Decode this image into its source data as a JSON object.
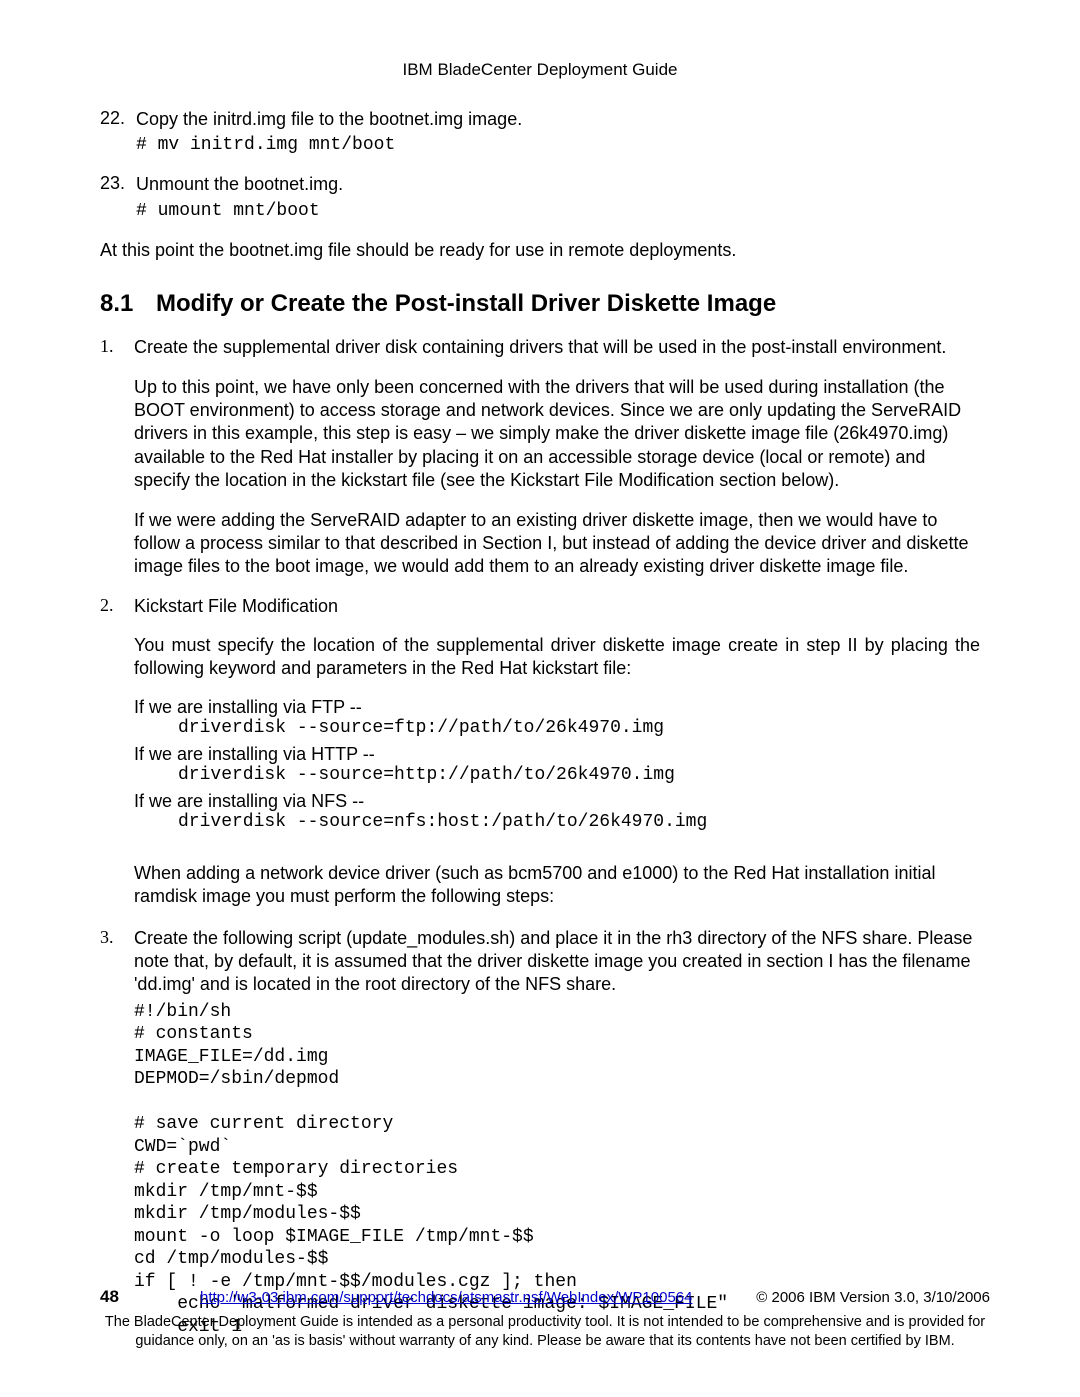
{
  "header": {
    "title": "IBM BladeCenter Deployment Guide"
  },
  "steps": {
    "s22": {
      "num": "22.",
      "text": "Copy the initrd.img file to the bootnet.img image.",
      "cmd": "# mv initrd.img mnt/boot"
    },
    "s23": {
      "num": "23.",
      "text": "Unmount the bootnet.img.",
      "cmd": "# umount mnt/boot"
    }
  },
  "closing": "At this point the bootnet.img file should be ready for use in remote deployments.",
  "section": {
    "num": "8.1",
    "title": "Modify or Create the Post-install Driver Diskette Image"
  },
  "list": {
    "i1": {
      "num": "1.",
      "lead": "Create the supplemental driver disk containing drivers that will be used in the post-install environment.",
      "p1": "Up to this point, we have only been concerned with the drivers that will be used during installation (the BOOT environment) to access storage and network devices. Since we are only updating the ServeRAID drivers in this example, this step is easy – we simply make the driver diskette image file (26k4970.img) available to the Red Hat installer by placing it on an accessible storage device (local or remote) and specify the location in the kickstart file (see the Kickstart File Modification section below).",
      "p2": "If we were adding the ServeRAID adapter to an existing driver diskette image, then we would have to follow a process similar to that described in Section I, but instead of adding the device driver and diskette image files to the boot image, we would add them to an already existing driver diskette image file."
    },
    "i2": {
      "num": "2.",
      "lead": "Kickstart File Modification",
      "intro": "You must specify the location of the supplemental driver diskette image create in step II by placing the following keyword and parameters in the Red Hat kickstart file:",
      "ftp_l": "If we are installing via FTP --",
      "ftp_c": "driverdisk --source=ftp://path/to/26k4970.img",
      "http_l": "If we are installing via HTTP --",
      "http_c": "driverdisk --source=http://path/to/26k4970.img",
      "nfs_l": "If we are installing via NFS --",
      "nfs_c": "driverdisk --source=nfs:host:/path/to/26k4970.img",
      "tail": "When adding a network device driver (such as bcm5700 and e1000) to the Red Hat installation initial ramdisk image you must perform the following steps:"
    },
    "i3": {
      "num": "3.",
      "lead": "Create the following script (update_modules.sh) and place it in the rh3 directory of the NFS share. Please note that, by default, it is assumed that the driver diskette image you created in section I has the filename 'dd.img' and is located in the root directory of the NFS share.",
      "script": "#!/bin/sh\n# constants\nIMAGE_FILE=/dd.img\nDEPMOD=/sbin/depmod\n\n# save current directory\nCWD=`pwd`\n# create temporary directories\nmkdir /tmp/mnt-$$\nmkdir /tmp/modules-$$\nmount -o loop $IMAGE_FILE /tmp/mnt-$$\ncd /tmp/modules-$$\nif [ ! -e /tmp/mnt-$$/modules.cgz ]; then\n    echo \"malformed driver diskette image: $IMAGE_FILE\"\n    exit 1"
    }
  },
  "footer": {
    "page": "48",
    "url": "http://w3-03.ibm.com/support/techdocs/atsmastr.nsf/WebIndex/WP100564",
    "copy": "© 2006 IBM Version 3.0, 3/10/2006",
    "disc": "The BladeCenter Deployment Guide is intended as a personal productivity tool. It is not intended to be comprehensive and is provided for guidance only, on an 'as is basis' without warranty of any kind. Please be aware that its contents have not been certified by IBM."
  }
}
